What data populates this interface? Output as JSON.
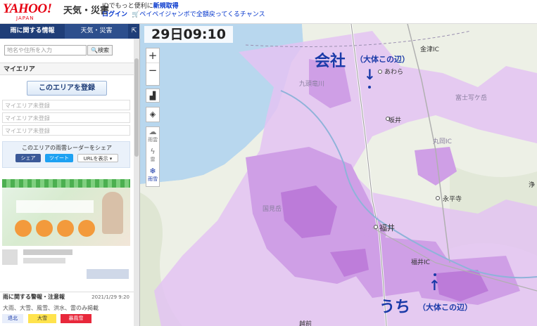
{
  "header": {
    "logo": "YAHOO!",
    "logo_sub": "JAPAN",
    "service_name": "天気・災害",
    "line1_prefix": "IDでもっと便利に",
    "line1_link": "新規取得",
    "login": "ログイン",
    "promo": "ペイペイジャンボで全額戻ってくるチャンス"
  },
  "sidebar": {
    "tab_active": "雨に関する情報",
    "tab_inactive": "天気・災害",
    "collapse": "⇱",
    "search_placeholder": "地名や住所を入力",
    "search_button": "検索",
    "my_area_title": "マイエリア",
    "register_button": "このエリアを登録",
    "area_slots": [
      "マイエリア未登録",
      "マイエリア未登録",
      "マイエリア未登録"
    ],
    "share_text": "このエリアの雨雲レーダーをシェア",
    "share_fb": "シェア",
    "share_tw": "ツイート",
    "share_url": "URLを表示 ▾",
    "warn_title": "雨に関する警報・注意報",
    "warn_date": "2021/1/29 9:20",
    "warn_sub": "大雨、大雪、風雪、洪水、雷のみ掲載",
    "legend": [
      {
        "label": "退北",
        "color": "#e8eefb",
        "text": "#1a3aa8"
      },
      {
        "label": "大雪",
        "color": "#ffe34d",
        "text": "#333333"
      },
      {
        "label": "暴風雪",
        "color": "#e8283b",
        "text": "#ffffff"
      }
    ]
  },
  "map": {
    "time": "29日09:10",
    "zoom_in": "+",
    "zoom_out": "−",
    "layer_rain": "雨雲",
    "layer_thunder": "雷",
    "layer_snow": "雨雪",
    "annotation_office": "会社",
    "annotation_office_note": "（大体この辺）",
    "annotation_home": "うち",
    "annotation_home_note": "（大体この辺）",
    "arrow_down": "↓",
    "arrow_up": "↑",
    "places": {
      "kanazu_ic": "金津IC",
      "awara": "あわら",
      "sakai": "坂井",
      "fujisan": "富士写ケ岳",
      "maruoka_ic": "丸岡IC",
      "eiheiji": "永平寺",
      "fukui": "福井",
      "fukui_ic": "福井IC",
      "kunimidake": "国見岳",
      "echizen": "越前",
      "kuzuryugawa": "九頭竜川",
      "jo": "浄"
    },
    "colors": {
      "rain_light": "#e3c3f2",
      "rain_mid": "#cf9fe6",
      "rain_heavy": "#b66fd4",
      "sea": "#b8d7ee",
      "land": "#edf0e6",
      "annotation": "#1a3aa8"
    }
  }
}
